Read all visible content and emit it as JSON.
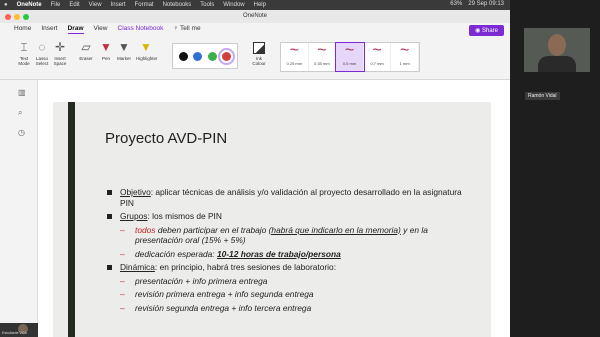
{
  "menubar": {
    "app": "OneNote",
    "items": [
      "File",
      "Edit",
      "View",
      "Insert",
      "Format",
      "Notebooks",
      "Tools",
      "Window",
      "Help"
    ],
    "battery": "63%",
    "datetime": "29 Sep 09:13"
  },
  "window": {
    "title": "OneNote"
  },
  "tabs": {
    "home": "Home",
    "insert": "Insert",
    "draw": "Draw",
    "view": "View",
    "class_notebook": "Class Notebook",
    "tell_me": "Tell me"
  },
  "share_label": "Share",
  "ribbon": {
    "text_mode": "Text Mode",
    "lasso": "Lasso Select",
    "insert_space": "Insert Space",
    "eraser": "Eraser",
    "pen": "Pen",
    "marker": "Marker",
    "highlighter": "Highlighter",
    "ink_colour": "Ink Colour",
    "thickness": [
      "0.25 mm",
      "0.35 mm",
      "0.5 mm",
      "0.7 mm",
      "1 mm"
    ]
  },
  "pen_colors": [
    "#111111",
    "#2f6fd6",
    "#3cae4c",
    "#d24040"
  ],
  "slide": {
    "title": "Proyecto AVD-PIN",
    "objetivo_label": "Objetivo",
    "objetivo_text": ": aplicar técnicas de análisis y/o validación al proyecto desarrollado en la asignatura PIN",
    "grupos_label": "Grupos",
    "grupos_text": ": los mismos de PIN",
    "sub1_red": "todos",
    "sub1_text": " deben participar en el trabajo ",
    "sub1_underlined": "(habrá que indicarlo en la memoria)",
    "sub1_tail": " y en la presentación oral (15% + 5%)",
    "sub2_text": "dedicación esperada: ",
    "sub2_bold": "10-12 horas de trabajo/persona",
    "dinamica_label": "Dinámica",
    "dinamica_text": ": en principio, habrá tres sesiones de laboratorio:",
    "sessions": [
      "presentación + info primera entrega",
      "revisión primera entrega + info segunda entrega",
      "revisión segunda entrega + info tercera entrega"
    ]
  },
  "video": {
    "speaker_label": "Ramón Vidal",
    "self_label": "Estudiante VCA"
  }
}
